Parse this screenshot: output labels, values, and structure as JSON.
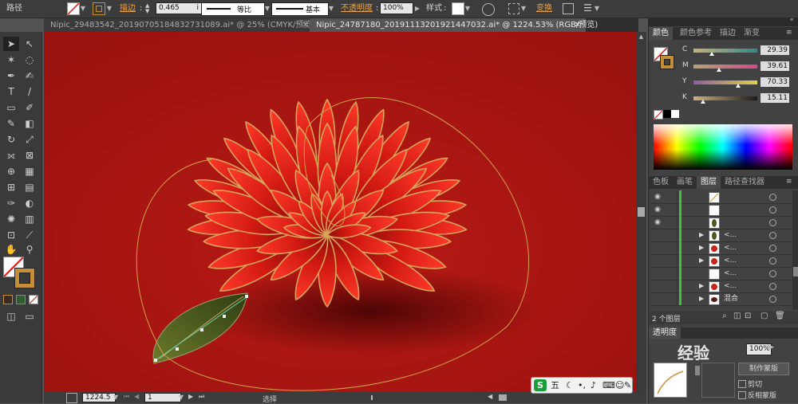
{
  "control_bar": {
    "object_type": "路径",
    "stroke_label": "描边",
    "stroke_weight": "0.465",
    "stroke_unit": "i",
    "profile": "等比",
    "brush": "基本",
    "opacity_label": "不透明度",
    "opacity_value": "100%",
    "style_label": "样式",
    "transform_label": "变换"
  },
  "document_tabs": [
    {
      "label": "Nipic_29483542_20190705184832731089.ai* @ 25% (CMYK/预览)",
      "active": false
    },
    {
      "label": "Nipic_24787180_20191113201921447032.ai* @ 1224.53% (RGB/预览)",
      "active": true
    }
  ],
  "status_bar": {
    "zoom": "1224.5",
    "page": "1",
    "tool_name": "选择"
  },
  "color_panel": {
    "tabs": [
      "颜色",
      "颜色参考",
      "描边",
      "渐变"
    ],
    "active_tab": "颜色",
    "channels": [
      {
        "label": "C",
        "value": "29.39",
        "fraction": 0.29
      },
      {
        "label": "M",
        "value": "39.61",
        "fraction": 0.4
      },
      {
        "label": "Y",
        "value": "70.33",
        "fraction": 0.7
      },
      {
        "label": "K",
        "value": "15.11",
        "fraction": 0.15
      }
    ]
  },
  "layers_panel": {
    "tabs": [
      "色板",
      "画笔",
      "图层",
      "路径查找器"
    ],
    "active_tab": "图层",
    "rows": [
      {
        "name": "",
        "eye": true,
        "thumb": "stroke",
        "has_arrow": false
      },
      {
        "name": "",
        "eye": true,
        "thumb": "blank",
        "has_arrow": false
      },
      {
        "name": "",
        "eye": true,
        "thumb": "leaf",
        "has_arrow": false
      },
      {
        "name": "<...",
        "eye": false,
        "thumb": "leaf",
        "has_arrow": true
      },
      {
        "name": "<...",
        "eye": false,
        "thumb": "flower",
        "has_arrow": true
      },
      {
        "name": "<...",
        "eye": false,
        "thumb": "flower",
        "has_arrow": true
      },
      {
        "name": "<...",
        "eye": false,
        "thumb": "blank",
        "has_arrow": false
      },
      {
        "name": "<...",
        "eye": false,
        "thumb": "flower",
        "has_arrow": true
      },
      {
        "name": "混合",
        "eye": false,
        "thumb": "dark",
        "has_arrow": true
      }
    ],
    "footer": "2 个图层"
  },
  "transparency_panel": {
    "opacity_value": "100%",
    "make_mask": "制作蒙版",
    "clip": "剪切",
    "invert_mask": "反相蒙版",
    "watermark": "经验"
  },
  "ime_bar": {
    "mode": "五"
  },
  "colors": {
    "canvas_red": "#a51511",
    "petal_stroke": "#d9a35a",
    "leaf": "#4a5a1c",
    "accent_orange": "#e8a24a"
  }
}
